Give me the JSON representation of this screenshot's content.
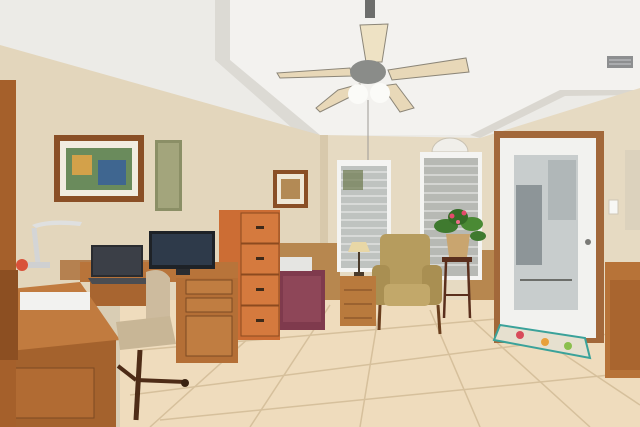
{
  "scene": {
    "kind": "photograph",
    "subject": "home-office"
  },
  "colors": {
    "ceiling": "#efeeea",
    "ceiling_shadow": "#d8d6d0",
    "wall": "#e4d7bf",
    "wall_shade": "#d6c7aa",
    "wainscot": "#b5834d",
    "floor_tile": "#eed9b8",
    "grout": "#d8c4a2",
    "wood": "#b86f35",
    "wood_dark": "#8c4f22",
    "cabinet": "#d0703a",
    "chair_fabric": "#b49a5b",
    "door": "#f3f3f0",
    "glass": "#c9cfd0",
    "mat_accent": "#3fa8a0"
  },
  "icons": {
    "fan": "ceiling-fan-icon",
    "lamp": "desk-lamp-icon",
    "plant": "potted-plant-icon"
  }
}
